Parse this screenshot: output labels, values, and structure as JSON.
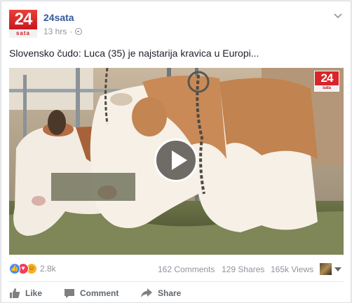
{
  "post": {
    "page_name": "24sata",
    "avatar_text": "24",
    "avatar_subtext": "sata",
    "time": "13 hrs",
    "separator": "·",
    "privacy_icon": "globe-icon",
    "menu_icon": "chevron-down-icon",
    "text": "Slovensko čudo: Luca (35) je najstarija kravica u Europi..."
  },
  "video": {
    "watermark_text": "24",
    "watermark_subtext": "sata",
    "play_icon": "play-icon"
  },
  "stats": {
    "reaction_icons": [
      "like-reaction-icon",
      "love-reaction-icon",
      "haha-reaction-icon"
    ],
    "reaction_count": "2.8k",
    "comments": "162 Comments",
    "shares": "129 Shares",
    "views": "165k Views"
  },
  "actions": {
    "like_label": "Like",
    "comment_label": "Comment",
    "share_label": "Share"
  },
  "colors": {
    "link_blue": "#365899",
    "meta_gray": "#90949c",
    "action_gray": "#606770",
    "brand_red": "#d9252a",
    "like_blue": "#4a8cff",
    "love_red": "#f33e58",
    "haha_yellow": "#f7b125"
  }
}
